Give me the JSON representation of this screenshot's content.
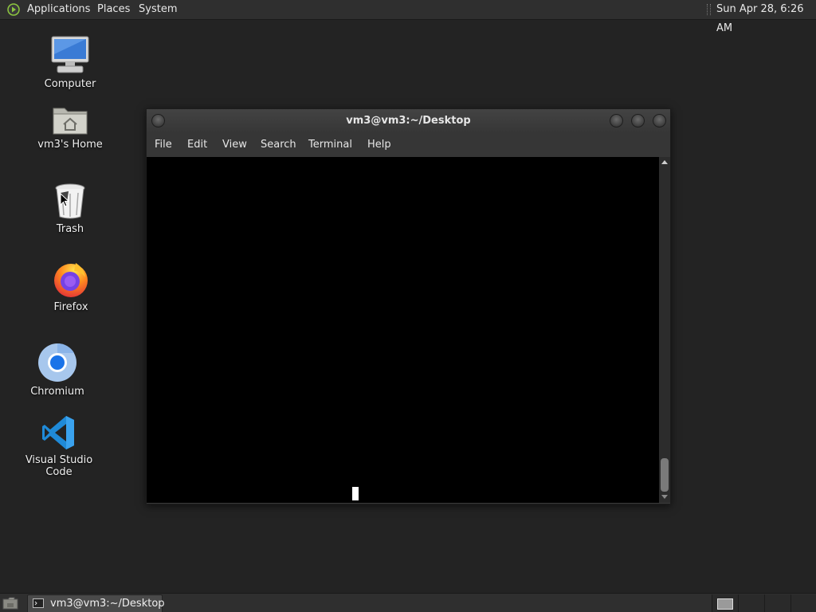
{
  "top_panel": {
    "menus": [
      "Applications",
      "Places",
      "System"
    ],
    "clock": "Sun Apr 28,  6:26 AM"
  },
  "desktop_icons": [
    {
      "label": "Computer",
      "icon": "computer-icon"
    },
    {
      "label": "vm3's Home",
      "icon": "home-folder-icon"
    },
    {
      "label": "Trash",
      "icon": "trash-icon"
    },
    {
      "label": "Firefox",
      "icon": "firefox-icon"
    },
    {
      "label": "Chromium",
      "icon": "chromium-icon"
    },
    {
      "label": "Visual Studio Code",
      "icon": "vscode-icon"
    }
  ],
  "terminal": {
    "title": "vm3@vm3:~/Desktop",
    "menu": [
      "File",
      "Edit",
      "View",
      "Search",
      "Terminal",
      "Help"
    ],
    "background": "#000000",
    "cursor_color": "#ffffff"
  },
  "bottom_panel": {
    "task_label": "vm3@vm3:~/Desktop"
  },
  "colors": {
    "panel": "#2f2f2f",
    "desktop": "#232323",
    "accent_green": "#8cc63f"
  }
}
